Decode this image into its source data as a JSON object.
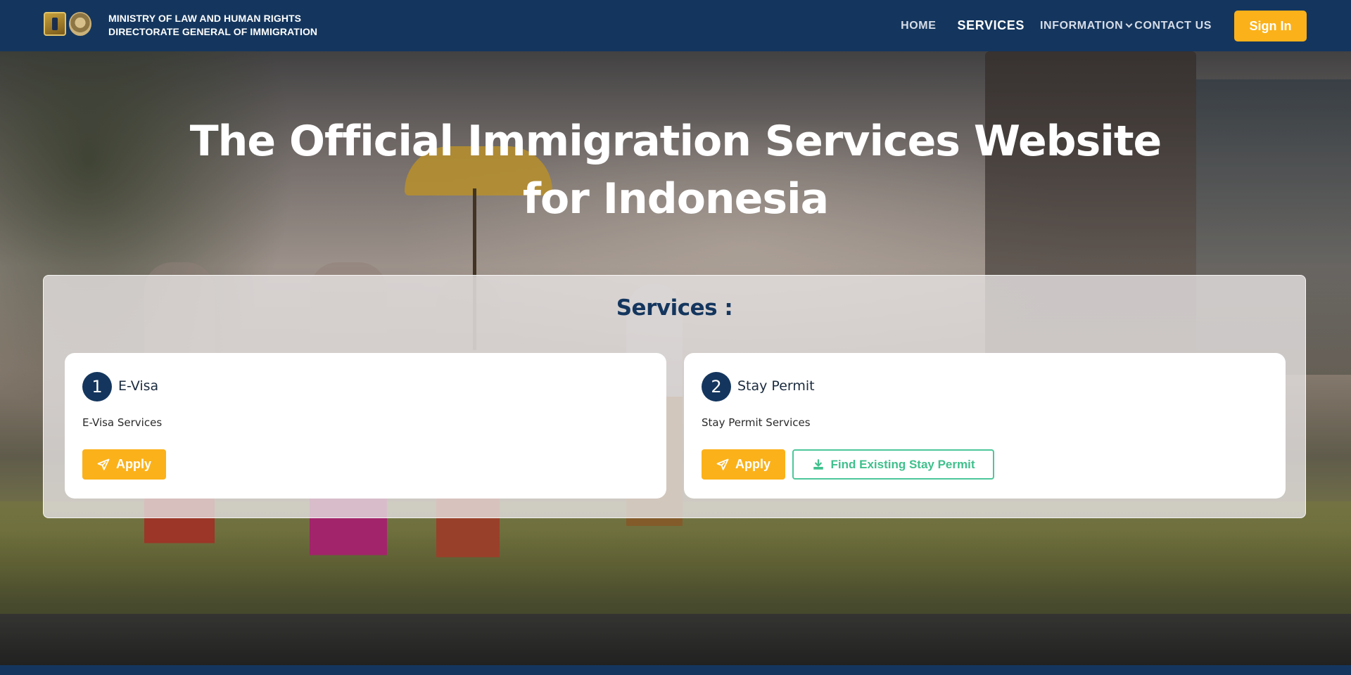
{
  "header": {
    "org_line1": "MINISTRY OF  LAW  AND HUMAN RIGHTS",
    "org_line2": "DIRECTORATE GENERAL OF IMMIGRATION",
    "nav": {
      "home": "HOME",
      "services": "SERVICES",
      "information": "INFORMATION",
      "contact": "CONTACT US"
    },
    "sign_in": "Sign In"
  },
  "hero": {
    "title_line1": "The Official Immigration Services Website",
    "title_line2": "for Indonesia"
  },
  "services": {
    "heading": "Services :",
    "cards": [
      {
        "number": "1",
        "title": "E-Visa",
        "description": "E-Visa Services",
        "apply_label": "Apply"
      },
      {
        "number": "2",
        "title": "Stay Permit",
        "description": "Stay Permit Services",
        "apply_label": "Apply",
        "find_label": "Find Existing Stay Permit"
      }
    ]
  },
  "colors": {
    "navy": "#14365e",
    "accent_yellow": "#fbb11a",
    "accent_green": "#3fc08c"
  },
  "icons": {
    "apply": "paper-plane-icon",
    "find": "download-icon",
    "dropdown": "chevron-down-icon"
  }
}
